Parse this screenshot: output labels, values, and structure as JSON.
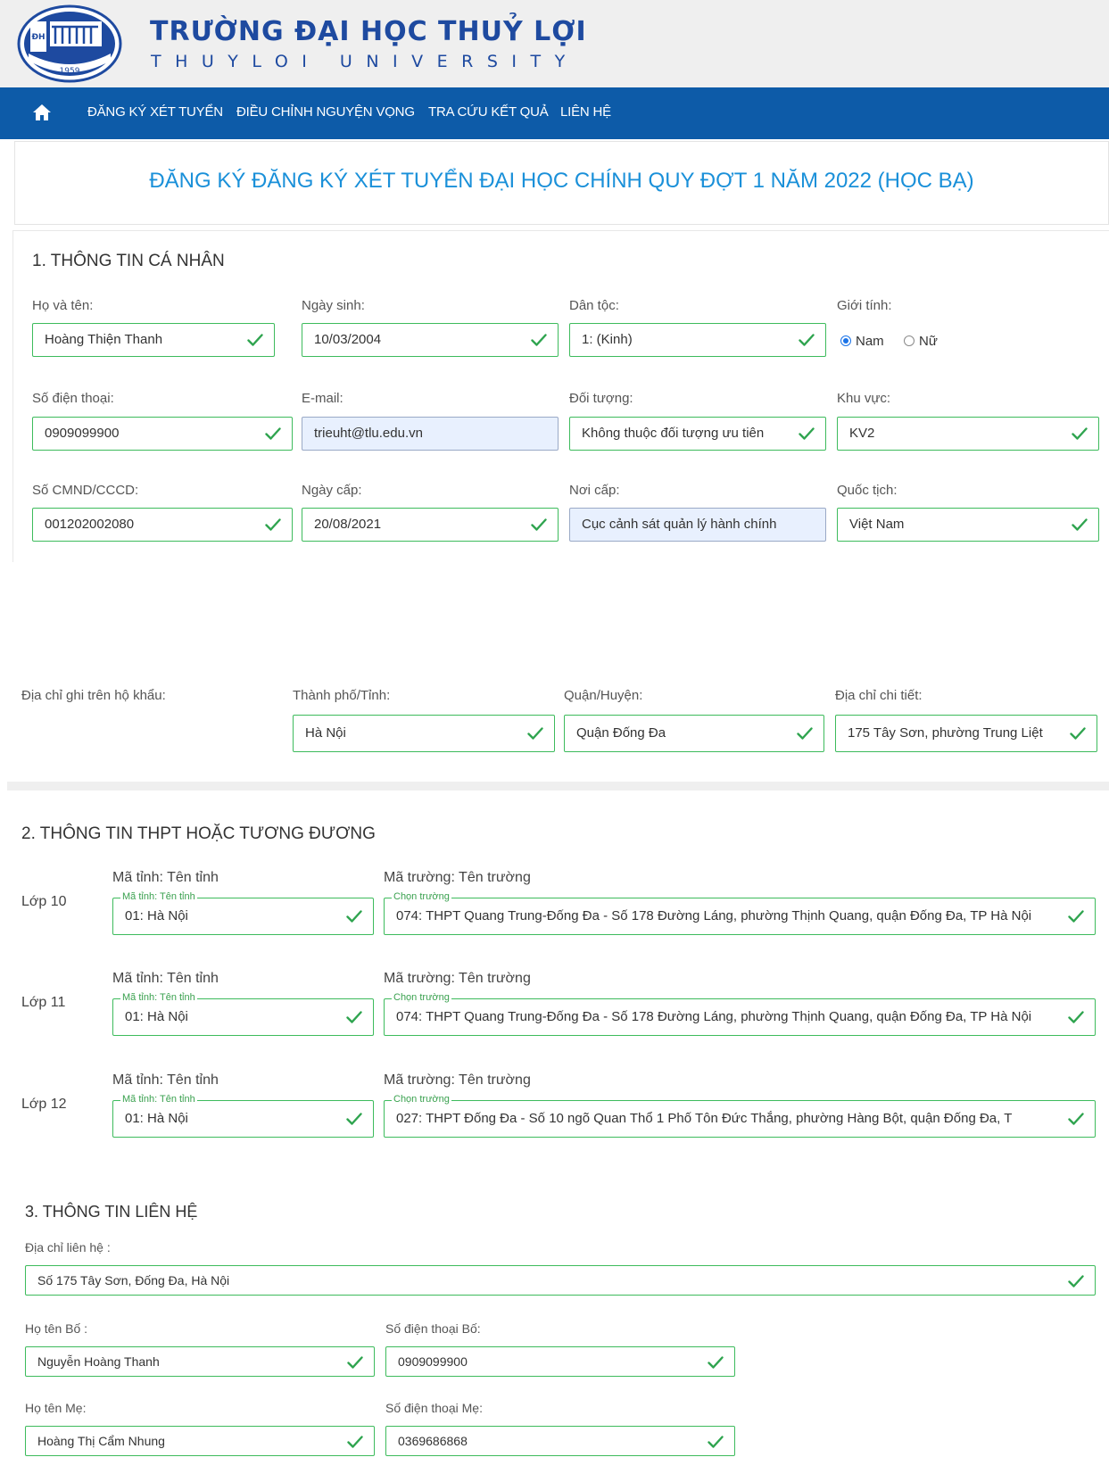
{
  "header": {
    "logo_year": "1959",
    "title": "TRƯỜNG ĐẠI HỌC THUỶ LỢI",
    "subtitle": "THUYLOI UNIVERSITY"
  },
  "nav": {
    "items": [
      "ĐĂNG KÝ XÉT TUYỂN",
      "ĐIỀU CHỈNH NGUYỆN VỌNG",
      "TRA CỨU KẾT QUẢ",
      "LIÊN HỆ"
    ]
  },
  "page_title": "ĐĂNG KÝ ĐĂNG KÝ XÉT TUYỂN ĐẠI HỌC CHÍNH QUY ĐỢT 1 NĂM 2022 (HỌC BẠ)",
  "personal": {
    "title": "1. THÔNG TIN CÁ NHÂN",
    "fullname": {
      "label": "Họ và tên:",
      "value": "Hoàng Thiện Thanh"
    },
    "dob": {
      "label": "Ngày sinh:",
      "value": "10/03/2004"
    },
    "ethnicity": {
      "label": "Dân tộc:",
      "value": "1: (Kinh)"
    },
    "gender": {
      "label": "Giới tính:",
      "options": [
        "Nam",
        "Nữ"
      ],
      "selected": "Nam"
    },
    "phone": {
      "label": "Số điện thoại:",
      "value": "0909099900"
    },
    "email": {
      "label": "E-mail:",
      "value": "trieuht@tlu.edu.vn"
    },
    "object": {
      "label": "Đối tượng:",
      "value": "Không thuộc đối tượng ưu tiên"
    },
    "area": {
      "label": "Khu vực:",
      "value": "KV2"
    },
    "id_number": {
      "label": "Số CMND/CCCD:",
      "value": "001202002080"
    },
    "issue_date": {
      "label": "Ngày cấp:",
      "value": "20/08/2021"
    },
    "issue_place": {
      "label": "Nơi cấp:",
      "value": "Cục cảnh sát quản lý hành chính"
    },
    "nationality": {
      "label": "Quốc tịch:",
      "value": "Việt Nam"
    }
  },
  "address": {
    "label": "Địa chỉ ghi trên hộ khẩu:",
    "city": {
      "label": "Thành phố/Tỉnh:",
      "value": "Hà Nội"
    },
    "district": {
      "label": "Quận/Huyện:",
      "value": "Quận Đống Đa"
    },
    "detail": {
      "label": "Địa chỉ chi tiết:",
      "value": "175 Tây Sơn, phường Trung Liệt"
    }
  },
  "school": {
    "title": "2. THÔNG TIN THPT HOẶC TƯƠNG ĐƯƠNG",
    "province_label": "Mã tỉnh: Tên tỉnh",
    "province_legend": "Mã tỉnh: Tên tỉnh",
    "school_label": "Mã trường: Tên trường",
    "school_legend": "Chọn trường",
    "rows": [
      {
        "grade": "Lớp 10",
        "province": "01: Hà Nội",
        "school": "074: THPT Quang Trung-Đống Đa - Số 178 Đường Láng, phường Thịnh Quang, quận Đống Đa, TP Hà Nội"
      },
      {
        "grade": "Lớp 11",
        "province": "01: Hà Nội",
        "school": "074: THPT Quang Trung-Đống Đa - Số 178 Đường Láng, phường Thịnh Quang, quận Đống Đa, TP Hà Nội"
      },
      {
        "grade": "Lớp 12",
        "province": "01: Hà Nội",
        "school": "027: THPT Đống Đa - Số 10 ngõ Quan Thổ 1 Phố Tôn Đức Thắng, phường Hàng Bột, quận Đống Đa, T"
      }
    ]
  },
  "contact": {
    "title": "3. THÔNG TIN LIÊN HỆ",
    "address": {
      "label": "Địa chỉ liên hệ :",
      "value": "Số 175 Tây Sơn, Đống Đa, Hà Nội"
    },
    "father_name": {
      "label": "Họ tên Bố :",
      "value": "Nguyễn Hoàng Thanh"
    },
    "father_phone": {
      "label": "Số điện thoại Bố:",
      "value": "0909099900"
    },
    "mother_name": {
      "label": "Họ tên Mẹ:",
      "value": "Hoàng Thị Cẩm Nhung"
    },
    "mother_phone": {
      "label": "Số điện thoại Mẹ:",
      "value": "0369686868"
    }
  },
  "colors": {
    "brand_blue": "#1e4aa0",
    "nav_blue": "#0d5ba8",
    "title_blue": "#1a90d9",
    "valid_green": "#3dbb5c"
  },
  "icons": {
    "home": "home-icon",
    "valid": "check-icon"
  }
}
